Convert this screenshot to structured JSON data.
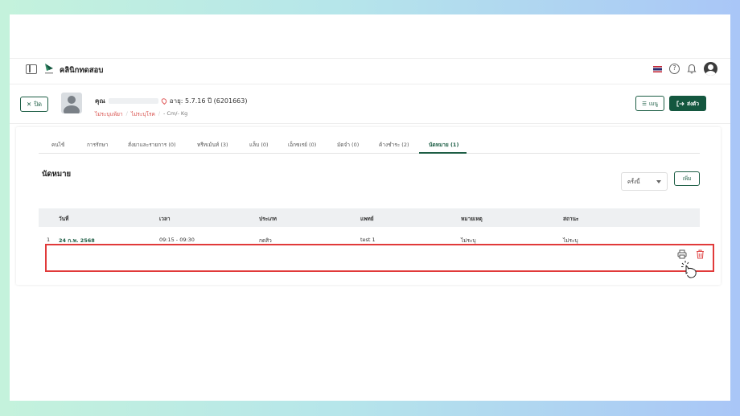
{
  "header": {
    "clinic_name": "คลินิกทดสอบ"
  },
  "patient": {
    "title": "คุณ",
    "age": "อายุ: 5.7.16 ปี  (6201663)",
    "allergy": "ไม่ระบุแพ้ยา",
    "disease": "ไม่ระบุโรค",
    "body": "- Cm/- Kg",
    "close_label": "ปิด",
    "menu_label": "เมนู",
    "send_label": "ส่งตัว"
  },
  "tabs": [
    {
      "label": "คนไข้"
    },
    {
      "label": "การรักษา"
    },
    {
      "label": "สั่งยาและรายการ (0)"
    },
    {
      "label": "ทรีทเม้นท์ (3)"
    },
    {
      "label": "แล็บ (0)"
    },
    {
      "label": "เอ็กซเรย์ (0)"
    },
    {
      "label": "มัดจำ (0)"
    },
    {
      "label": "ค้างชำระ (2)"
    },
    {
      "label": "นัดหมาย (1)"
    }
  ],
  "active_tab": "นัดหมาย (1)",
  "section": {
    "title": "นัดหมาย",
    "filter_value": "ครั้งนี้",
    "add_label": "เพิ่ม"
  },
  "table": {
    "columns": [
      "วันที่",
      "เวลา",
      "ประเภท",
      "แพทย์",
      "หมายเหตุ",
      "สถานะ"
    ],
    "rows": [
      {
        "no": "1",
        "date": "24 ก.พ. 2568",
        "time": "09:15 - 09:30",
        "type": "กดสิว",
        "doctor": "test 1",
        "note": "ไม่ระบุ",
        "status": "ไม่ระบุ"
      }
    ]
  },
  "colors": {
    "primary": "#14573f",
    "highlight": "#e13a3a",
    "danger": "#d9534f"
  },
  "icons": [
    "sidebar-toggle-icon",
    "clinic-logo",
    "thai-flag-icon",
    "help-icon",
    "bell-icon",
    "user-avatar-icon",
    "location-pin-icon",
    "close-icon",
    "menu-icon",
    "send-icon",
    "print-icon",
    "trash-icon",
    "click-cursor-icon"
  ]
}
